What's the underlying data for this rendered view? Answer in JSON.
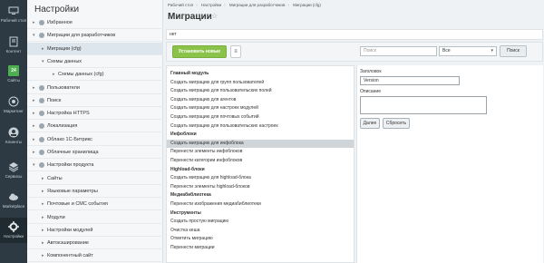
{
  "rail": [
    {
      "label": "Рабочий стол",
      "icon": "desktop-icon"
    },
    {
      "label": "Контент",
      "icon": "document-icon"
    },
    {
      "label": "Сайты",
      "icon": "calendar-icon",
      "badge": "24"
    },
    {
      "label": "Маркетинг",
      "icon": "target-icon"
    },
    {
      "label": "Клиенты",
      "icon": "users-icon"
    },
    {
      "label": "Сервисы",
      "icon": "layers-icon"
    },
    {
      "label": "Marketplace",
      "icon": "cloud-icon"
    },
    {
      "label": "Настройки",
      "icon": "gear-icon"
    }
  ],
  "panel": {
    "title": "Настройки",
    "items": [
      {
        "label": "Избранное",
        "level": 0,
        "icon": "star"
      },
      {
        "label": "Миграции для разработчиков",
        "level": 0,
        "icon": "module",
        "open": true
      },
      {
        "label": "Миграции (cfg)",
        "level": 1,
        "selected": true
      },
      {
        "label": "Схемы данных",
        "level": 1,
        "open": true
      },
      {
        "label": "Схемы данных (cfg)",
        "level": 2
      },
      {
        "label": "Пользователи",
        "level": 0,
        "icon": "users"
      },
      {
        "label": "Поиск",
        "level": 0,
        "icon": "search"
      },
      {
        "label": "Настройка HTTPS",
        "level": 0,
        "icon": "https"
      },
      {
        "label": "Локализация",
        "level": 0,
        "icon": "globe"
      },
      {
        "label": "Облако 1С-Битрикс",
        "level": 0,
        "icon": "cloud"
      },
      {
        "label": "Облачные хранилища",
        "level": 0,
        "icon": "storage"
      },
      {
        "label": "Настройки продукта",
        "level": 0,
        "icon": "gear",
        "open": true
      },
      {
        "label": "Сайты",
        "level": 1
      },
      {
        "label": "Языковые параметры",
        "level": 1
      },
      {
        "label": "Почтовые и СМС события",
        "level": 1
      },
      {
        "label": "Модули",
        "level": 1
      },
      {
        "label": "Настройки модулей",
        "level": 1
      },
      {
        "label": "Автокэширование",
        "level": 1
      },
      {
        "label": "Компонентный сайт",
        "level": 1
      }
    ]
  },
  "breadcrumbs": [
    "Рабочий стол",
    "Настройки",
    "Миграции для разработчиков",
    "Миграции (cfg)"
  ],
  "page_title": "Миграции",
  "nav_box_text": "нет",
  "toolbar": {
    "install_label": "Установить новые",
    "menu_label": "≡",
    "search_placeholder": "Поиск",
    "select_value": "Все",
    "search_button": "Поиск"
  },
  "list": [
    {
      "text": "Главный модуль",
      "head": true
    },
    {
      "text": "Создать миграцию для групп пользователей"
    },
    {
      "text": "Создать миграцию для пользовательских полей"
    },
    {
      "text": "Создать миграцию для агентов"
    },
    {
      "text": "Создать миграцию для настроек модулей"
    },
    {
      "text": "Создать миграцию для почтовых событий"
    },
    {
      "text": "Создать миграцию для пользовательских настроек"
    },
    {
      "text": "Инфоблоки",
      "head": true
    },
    {
      "text": "Создать миграцию для инфоблока",
      "selected": true
    },
    {
      "text": "Перенести элементы инфоблоков"
    },
    {
      "text": "Перенести категории инфоблоков"
    },
    {
      "text": "Highload-блоки",
      "head": true
    },
    {
      "text": "Создать миграцию для highload-блока"
    },
    {
      "text": "Перенести элементы highload-блоков"
    },
    {
      "text": "Медиабиблиотека",
      "head": true
    },
    {
      "text": "Перенести изображения медиабиблиотеки"
    },
    {
      "text": "Инструменты",
      "head": true
    },
    {
      "text": "Создать простую миграцию"
    },
    {
      "text": "Очистка кеша"
    },
    {
      "text": "Отметить миграцию"
    },
    {
      "text": "Перенести миграции"
    }
  ],
  "form": {
    "title_label": "Заголовок",
    "title_value": "Version",
    "description_label": "Описание",
    "next_button": "Далее",
    "reset_button": "Сбросить"
  },
  "colors": {
    "rail_bg": "#2d3a44",
    "accent_green": "#8bc34a",
    "badge_green": "#4caf50"
  }
}
